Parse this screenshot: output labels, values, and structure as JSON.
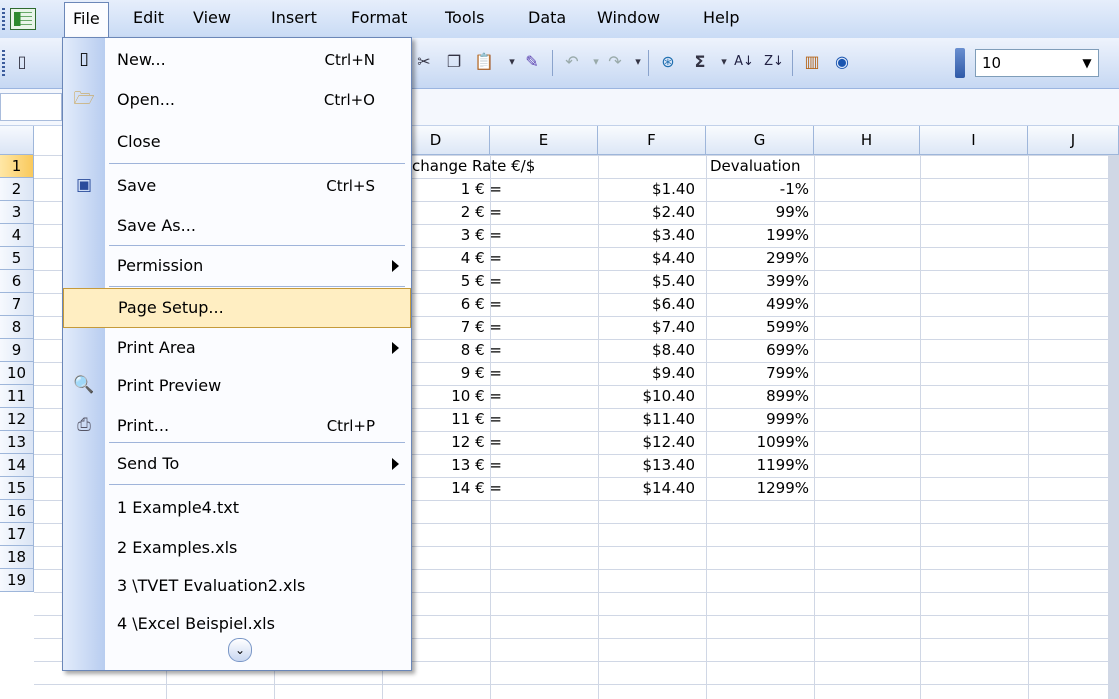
{
  "menubar": {
    "items": [
      "File",
      "Edit",
      "View",
      "Insert",
      "Format",
      "Tools",
      "Data",
      "Window",
      "Help"
    ],
    "open_menu": "File"
  },
  "toolbar": {
    "font_size": "10",
    "icons": [
      "new-icon",
      "cut-icon",
      "copy-icon",
      "paste-icon",
      "format-painter-icon",
      "undo-icon",
      "redo-icon",
      "hyperlink-icon",
      "autosum-icon",
      "sort-ascending-icon",
      "sort-descending-icon",
      "chart-wizard-icon",
      "help-icon"
    ]
  },
  "grid": {
    "columns": [
      "D",
      "E",
      "F",
      "G",
      "H",
      "I",
      "J"
    ],
    "rows": [
      "1",
      "2",
      "3",
      "4",
      "5",
      "6",
      "7",
      "8",
      "9",
      "10",
      "11",
      "12",
      "13",
      "14",
      "15",
      "16",
      "17",
      "18",
      "19"
    ],
    "header_row": {
      "d": "change Rate €/$",
      "g": "Devaluation"
    },
    "data": [
      {
        "d": "1 € =",
        "f": "$1.40",
        "g": "-1%"
      },
      {
        "d": "2 € =",
        "f": "$2.40",
        "g": "99%"
      },
      {
        "d": "3 € =",
        "f": "$3.40",
        "g": "199%"
      },
      {
        "d": "4 € =",
        "f": "$4.40",
        "g": "299%"
      },
      {
        "d": "5 € =",
        "f": "$5.40",
        "g": "399%"
      },
      {
        "d": "6 € =",
        "f": "$6.40",
        "g": "499%"
      },
      {
        "d": "7 € =",
        "f": "$7.40",
        "g": "599%"
      },
      {
        "d": "8 € =",
        "f": "$8.40",
        "g": "699%"
      },
      {
        "d": "9 € =",
        "f": "$9.40",
        "g": "799%"
      },
      {
        "d": "10 € =",
        "f": "$10.40",
        "g": "899%"
      },
      {
        "d": "11 € =",
        "f": "$11.40",
        "g": "999%"
      },
      {
        "d": "12 € =",
        "f": "$12.40",
        "g": "1099%"
      },
      {
        "d": "13 € =",
        "f": "$13.40",
        "g": "1199%"
      },
      {
        "d": "14 € =",
        "f": "$14.40",
        "g": "1299%"
      }
    ]
  },
  "file_menu": {
    "items": [
      {
        "label": "New...",
        "shortcut": "Ctrl+N",
        "icon": "new-document-icon"
      },
      {
        "label": "Open...",
        "shortcut": "Ctrl+O",
        "icon": "open-folder-icon"
      },
      {
        "label": "Close",
        "shortcut": ""
      },
      {
        "label": "Save",
        "shortcut": "Ctrl+S",
        "icon": "save-disk-icon"
      },
      {
        "label": "Save As...",
        "shortcut": ""
      },
      {
        "label": "Permission",
        "shortcut": "",
        "submenu": true
      },
      {
        "label": "Page Setup...",
        "shortcut": "",
        "highlighted": true
      },
      {
        "label": "Print Area",
        "shortcut": "",
        "submenu": true
      },
      {
        "label": "Print Preview",
        "shortcut": "",
        "icon": "print-preview-icon"
      },
      {
        "label": "Print...",
        "shortcut": "Ctrl+P",
        "icon": "printer-icon"
      },
      {
        "label": "Send To",
        "shortcut": "",
        "submenu": true
      },
      {
        "label": "1 Example4.txt",
        "shortcut": ""
      },
      {
        "label": "2 Examples.xls",
        "shortcut": ""
      },
      {
        "label": "3 \\TVET Evaluation2.xls",
        "shortcut": ""
      },
      {
        "label": "4 \\Excel Beispiel.xls",
        "shortcut": ""
      }
    ]
  },
  "colors": {
    "menu_highlight": "#ffeec2",
    "toolbar_blue": "#c6d8f3",
    "gridline": "#d0d7e5"
  }
}
